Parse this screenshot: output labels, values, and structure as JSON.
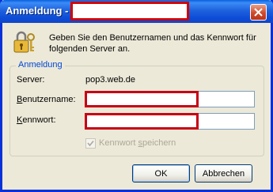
{
  "window": {
    "title": "Anmeldung -",
    "close_icon": "close-icon"
  },
  "message": "Geben Sie den Benutzernamen und das Kennwort für folgenden Server an.",
  "group": {
    "legend": "Anmeldung"
  },
  "server": {
    "label": "Server:",
    "value": "pop3.web.de"
  },
  "username": {
    "label_underlined": "B",
    "label_rest": "enutzername:",
    "value": ""
  },
  "password": {
    "label_underlined": "K",
    "label_rest": "ennwort:",
    "value": ""
  },
  "remember": {
    "label_prefix": "Kennwort ",
    "label_underlined": "s",
    "label_rest": "peichern",
    "checked": true
  },
  "buttons": {
    "ok": "OK",
    "cancel": "Abbrechen"
  },
  "colors": {
    "title_bar": "#1f62de",
    "redaction": "#d10000",
    "legend": "#0046d5",
    "disabled_text": "#aca899"
  }
}
